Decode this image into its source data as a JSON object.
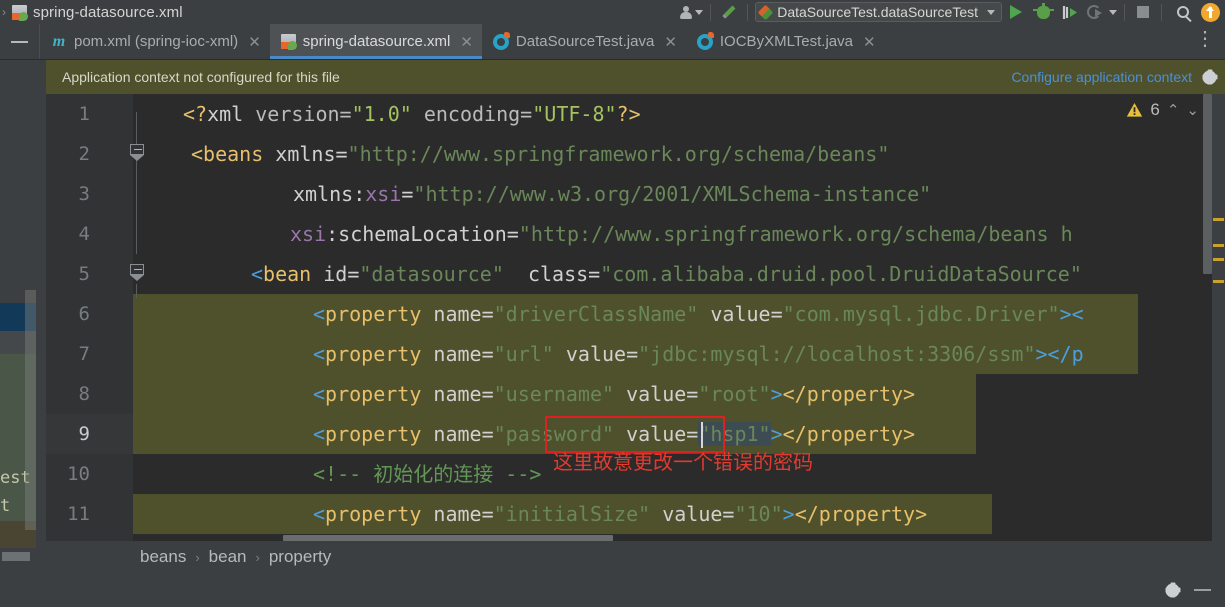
{
  "window": {
    "title": "spring-datasource.xml",
    "title_icon": "xml-file-icon"
  },
  "toolbar": {
    "breadcrumb_caret": "›",
    "user_icon": "user-avatar-icon",
    "user_dropdown_caret": "▾",
    "wrench_icon": "wrench-icon",
    "run_configuration": "DataSourceTest.dataSourceTest",
    "run_config_caret": "▾",
    "run_icon": "run-play-icon",
    "debug_icon": "debug-bug-icon",
    "run_with_coverage_icon": "run-with-coverage-icon",
    "profile_icon": "profiler-icon",
    "profile_caret": "▾",
    "stop_icon": "stop-icon",
    "search_icon": "search-everywhere-icon",
    "update_icon": "update-project-icon"
  },
  "tabs": {
    "minimize_label": "—",
    "close_label": "✕",
    "items": [
      {
        "label": "pom.xml (spring-ioc-xml)",
        "icon": "maven-file-icon",
        "active": false
      },
      {
        "label": "spring-datasource.xml",
        "icon": "spring-xml-file-icon",
        "active": true
      },
      {
        "label": "DataSourceTest.java",
        "icon": "java-class-icon",
        "active": false
      },
      {
        "label": "IOCByXMLTest.java",
        "icon": "java-class-icon",
        "active": false
      }
    ]
  },
  "notification": {
    "message": "Application context not configured for this file",
    "action": "Configure application context",
    "gear_icon": "gear-icon"
  },
  "inspection": {
    "warning_icon": "warning-triangle-icon",
    "warning_count": "6",
    "prev_icon": "chevron-up-icon",
    "next_icon": "chevron-down-icon"
  },
  "editor": {
    "line_numbers": [
      "1",
      "2",
      "3",
      "4",
      "5",
      "6",
      "7",
      "8",
      "9",
      "10",
      "11"
    ],
    "current_line": 9,
    "caret_after_text": "hsp1",
    "lines": [
      {
        "n": 1,
        "indent": 0,
        "highlight": "none",
        "tokens": [
          {
            "t": "<?",
            "c": "t-tag"
          },
          {
            "t": "xml",
            "c": "t-white"
          },
          {
            "t": " version=",
            "c": "t-attr"
          },
          {
            "t": "\"1.0\"",
            "c": "t-val"
          },
          {
            "t": " encoding=",
            "c": "t-attr"
          },
          {
            "t": "\"UTF-8\"",
            "c": "t-val"
          },
          {
            "t": "?>",
            "c": "t-tag"
          }
        ]
      },
      {
        "n": 2,
        "indent": 0,
        "highlight": "none",
        "tokens": [
          {
            "t": "<",
            "c": "t-tag"
          },
          {
            "t": "beans",
            "c": "t-tag"
          },
          {
            "t": " xmlns=",
            "c": "t-white"
          },
          {
            "t": "\"http://www.springframework.org/schema/beans\"",
            "c": "t-str"
          }
        ]
      },
      {
        "n": 3,
        "indent": 8,
        "highlight": "none",
        "tokens": [
          {
            "t": "xmlns:",
            "c": "t-white"
          },
          {
            "t": "xsi",
            "c": "t-ns"
          },
          {
            "t": "=",
            "c": "t-white"
          },
          {
            "t": "\"http://www.w3.org/2001/XMLSchema-instance\"",
            "c": "t-str"
          }
        ]
      },
      {
        "n": 4,
        "indent": 7,
        "highlight": "none",
        "tokens": [
          {
            "t": "xsi",
            "c": "t-ns"
          },
          {
            "t": ":schemaLocation=",
            "c": "t-white"
          },
          {
            "t": "\"http://www.springframework.org/schema/beans h",
            "c": "t-str"
          }
        ]
      },
      {
        "n": 5,
        "indent": 3,
        "highlight": "none",
        "tokens": [
          {
            "t": "<",
            "c": "t-brack"
          },
          {
            "t": "bean",
            "c": "t-tag"
          },
          {
            "t": " id=",
            "c": "t-white"
          },
          {
            "t": "\"datasource\"",
            "c": "t-str"
          },
          {
            "t": "  class=",
            "c": "t-white"
          },
          {
            "t": "\"com.alibaba.druid.pool.DruidDataSource\"",
            "c": "t-str"
          }
        ]
      },
      {
        "n": 6,
        "indent": 6,
        "highlight": "olive",
        "tokens": [
          {
            "t": "<",
            "c": "t-brack"
          },
          {
            "t": "property",
            "c": "t-tag"
          },
          {
            "t": " name=",
            "c": "t-white"
          },
          {
            "t": "\"driverClassName\"",
            "c": "t-str"
          },
          {
            "t": " value=",
            "c": "t-white"
          },
          {
            "t": "\"com.mysql.jdbc.Driver\"",
            "c": "t-str"
          },
          {
            "t": ">",
            "c": "t-brack"
          },
          {
            "t": "<",
            "c": "t-brack"
          }
        ]
      },
      {
        "n": 7,
        "indent": 6,
        "highlight": "olive",
        "tokens": [
          {
            "t": "<",
            "c": "t-brack"
          },
          {
            "t": "property",
            "c": "t-tag"
          },
          {
            "t": " name=",
            "c": "t-white"
          },
          {
            "t": "\"url\"",
            "c": "t-str"
          },
          {
            "t": " value=",
            "c": "t-white"
          },
          {
            "t": "\"jdbc:mysql://localhost:3306/ssm\"",
            "c": "t-str"
          },
          {
            "t": ">",
            "c": "t-brack"
          },
          {
            "t": "</p",
            "c": "t-brack"
          }
        ]
      },
      {
        "n": 8,
        "indent": 6,
        "highlight": "olive",
        "tokens": [
          {
            "t": "<",
            "c": "t-brack"
          },
          {
            "t": "property",
            "c": "t-tag"
          },
          {
            "t": " name=",
            "c": "t-white"
          },
          {
            "t": "\"username\"",
            "c": "t-str"
          },
          {
            "t": " value=",
            "c": "t-white"
          },
          {
            "t": "\"root\"",
            "c": "t-str"
          },
          {
            "t": ">",
            "c": "t-brack"
          },
          {
            "t": "</property>",
            "c": "t-tag"
          }
        ]
      },
      {
        "n": 9,
        "indent": 6,
        "highlight": "olive-current",
        "tokens": [
          {
            "t": "<",
            "c": "t-brack"
          },
          {
            "t": "property",
            "c": "t-tag"
          },
          {
            "t": " name=",
            "c": "t-white"
          },
          {
            "t": "\"password\"",
            "c": "t-str"
          },
          {
            "t": " value=",
            "c": "t-white"
          },
          {
            "t": "\"hsp1\"",
            "c": "t-str"
          },
          {
            "t": ">",
            "c": "t-brack"
          },
          {
            "t": "</property>",
            "c": "t-tag"
          }
        ]
      },
      {
        "n": 10,
        "indent": 6,
        "highlight": "none",
        "tokens": [
          {
            "t": "<!-- 初始化的连接 -->",
            "c": "t-comment"
          }
        ]
      },
      {
        "n": 11,
        "indent": 6,
        "highlight": "olive",
        "tokens": [
          {
            "t": "<",
            "c": "t-brack"
          },
          {
            "t": "property",
            "c": "t-tag"
          },
          {
            "t": " name=",
            "c": "t-white"
          },
          {
            "t": "\"initialSize\"",
            "c": "t-str"
          },
          {
            "t": " value=",
            "c": "t-white"
          },
          {
            "t": "\"10\"",
            "c": "t-str"
          },
          {
            "t": ">",
            "c": "t-brack"
          },
          {
            "t": "</property>",
            "c": "t-tag"
          }
        ]
      }
    ],
    "annotation": {
      "text": "这里故意更改一个错误的密码",
      "color": "#e23b2e",
      "box_color": "#e02020"
    }
  },
  "breadcrumbs": {
    "sep": "›",
    "items": [
      "beans",
      "bean",
      "property"
    ]
  },
  "statusbar": {
    "gear_icon": "gear-icon",
    "minimize_icon": "minimize-icon"
  },
  "background_panel": {
    "texts": [
      "est",
      "t"
    ]
  },
  "colors": {
    "accent_tab": "#4a88c7",
    "notification_bg": "#4f512c",
    "editor_bg": "#2b2b2b",
    "annotation_red": "#e23b2e",
    "warning_yellow": "#e8bf3a"
  }
}
